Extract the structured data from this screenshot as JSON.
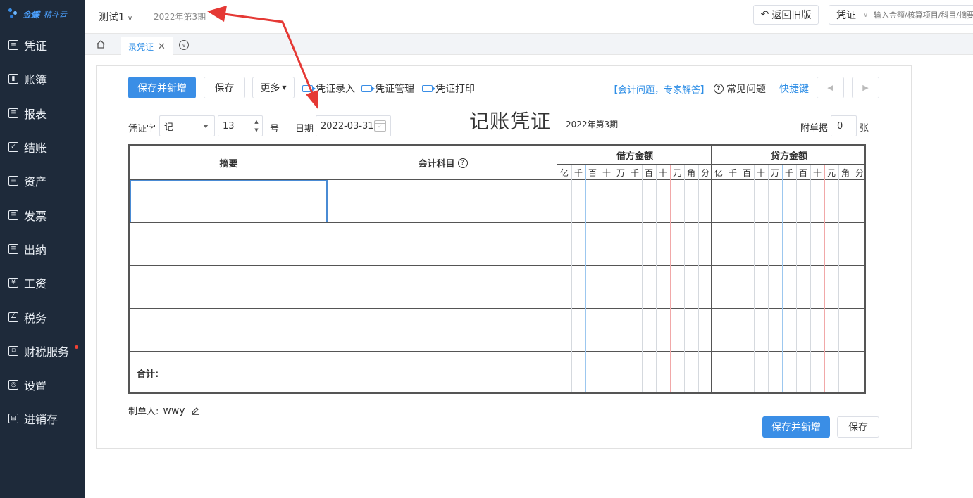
{
  "brand": {
    "name": "金蝶",
    "sub": "精斗云"
  },
  "sidebar": {
    "items": [
      {
        "label": "凭证",
        "glyph": "≡"
      },
      {
        "label": "账簿",
        "glyph": "▮"
      },
      {
        "label": "报表",
        "glyph": "≡"
      },
      {
        "label": "结账",
        "glyph": "✓"
      },
      {
        "label": "资产",
        "glyph": "≡"
      },
      {
        "label": "发票",
        "glyph": "≡"
      },
      {
        "label": "出纳",
        "glyph": "≡"
      },
      {
        "label": "工资",
        "glyph": "¥"
      },
      {
        "label": "税务",
        "glyph": "∠"
      },
      {
        "label": "财税服务",
        "glyph": "▫"
      },
      {
        "label": "设置",
        "glyph": "◎"
      },
      {
        "label": "进销存",
        "glyph": "⊟"
      }
    ]
  },
  "topbar": {
    "account": "测试1",
    "period": "2022年第3期",
    "back_label": "返回旧版",
    "search_type": "凭证",
    "search_placeholder": "输入金额/核算项目/科目/摘要"
  },
  "tabs": {
    "active": "录凭证"
  },
  "toolbar": {
    "save_new": "保存并新增",
    "save": "保存",
    "more": "更多",
    "links": [
      "凭证录入",
      "凭证管理",
      "凭证打印"
    ],
    "expert": "【会计问题，专家解答】",
    "faq": "常见问题",
    "shortcut": "快捷键"
  },
  "voucher": {
    "word_label": "凭证字",
    "word_value": "记",
    "number_value": "13",
    "number_suffix": "号",
    "date_label": "日期",
    "date_value": "2022-03-31",
    "title": "记账凭证",
    "period": "2022年第3期",
    "attach_label": "附单据",
    "attach_value": "0",
    "attach_unit": "张"
  },
  "table": {
    "col_summary": "摘要",
    "col_account": "会计科目",
    "col_debit": "借方金额",
    "col_credit": "贷方金额",
    "digits": [
      "亿",
      "千",
      "百",
      "十",
      "万",
      "千",
      "百",
      "十",
      "元",
      "角",
      "分"
    ],
    "total_label": "合计:",
    "rows": 4
  },
  "footer": {
    "maker_label": "制单人:",
    "maker_value": "wwy",
    "save_new": "保存并新增",
    "save": "保存"
  },
  "colors": {
    "sidebar_bg": "#1e2a3a",
    "accent": "#3a8ee6",
    "annotation_arrow": "#e53935"
  }
}
